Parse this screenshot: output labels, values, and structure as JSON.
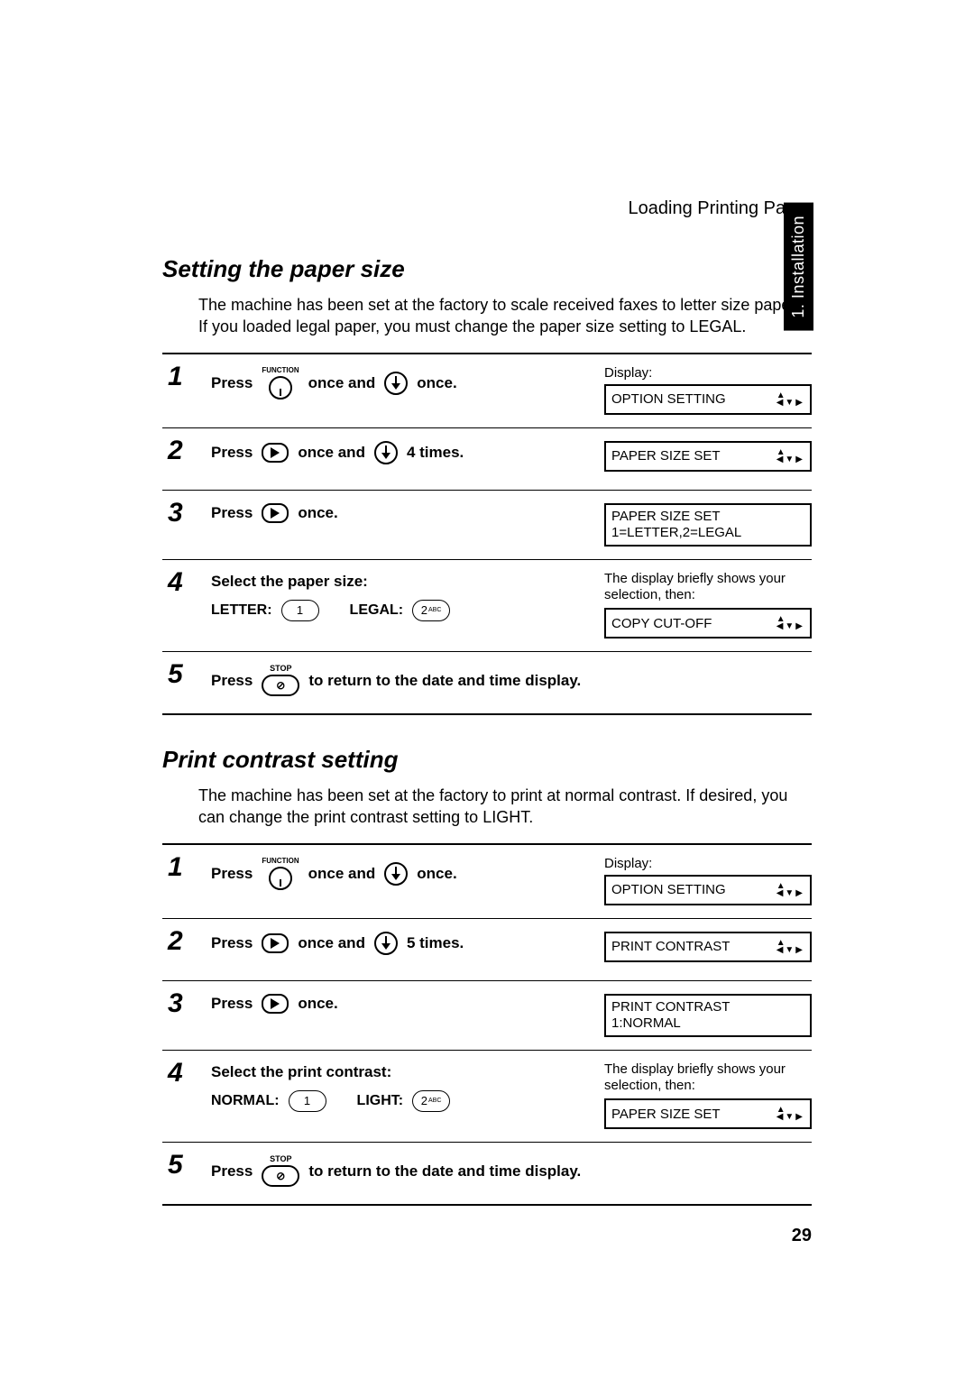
{
  "header": {
    "running_head": "Loading Printing Paper",
    "side_tab": "1. Installation"
  },
  "section1": {
    "title": "Setting the paper size",
    "intro": "The machine has been set at the factory to scale received faxes to letter size paper. If you loaded legal paper, you must change the paper size setting to LEGAL.",
    "steps": {
      "s1": {
        "num": "1",
        "press": "Press",
        "once_and": "once and",
        "once": "once.",
        "display_label": "Display:",
        "lcd": "OPTION SETTING"
      },
      "s2": {
        "num": "2",
        "press": "Press",
        "once_and": "once and",
        "times": "4 times.",
        "lcd": "PAPER SIZE SET"
      },
      "s3": {
        "num": "3",
        "press": "Press",
        "once": "once.",
        "lcd_l1": "PAPER SIZE SET",
        "lcd_l2": "1=LETTER,2=LEGAL"
      },
      "s4": {
        "num": "4",
        "select": "Select the paper size:",
        "opt1_label": "LETTER:",
        "opt1_key": "1",
        "opt2_label": "LEGAL:",
        "opt2_key": "2",
        "opt2_sub": "ABC",
        "note": "The display briefly shows your selection, then:",
        "lcd": "COPY CUT-OFF"
      },
      "s5": {
        "num": "5",
        "press": "Press",
        "tail": "to return to the date and time display."
      }
    }
  },
  "section2": {
    "title": "Print contrast setting",
    "intro": "The machine has been set at the factory to print at normal contrast. If desired, you can change the print contrast setting to LIGHT.",
    "steps": {
      "s1": {
        "num": "1",
        "press": "Press",
        "once_and": "once and",
        "once": "once.",
        "display_label": "Display:",
        "lcd": "OPTION SETTING"
      },
      "s2": {
        "num": "2",
        "press": "Press",
        "once_and": "once and",
        "times": "5 times.",
        "lcd": "PRINT CONTRAST"
      },
      "s3": {
        "num": "3",
        "press": "Press",
        "once": "once.",
        "lcd_l1": "PRINT CONTRAST",
        "lcd_l2": "1:NORMAL"
      },
      "s4": {
        "num": "4",
        "select": "Select the print contrast:",
        "opt1_label": "NORMAL:",
        "opt1_key": "1",
        "opt2_label": "LIGHT:",
        "opt2_key": "2",
        "opt2_sub": "ABC",
        "note": "The display briefly shows your selection, then:",
        "lcd": "PAPER SIZE SET"
      },
      "s5": {
        "num": "5",
        "press": "Press",
        "tail": "to return to the date and time display."
      }
    }
  },
  "key_labels": {
    "function": "FUNCTION",
    "stop": "STOP"
  },
  "page_number": "29"
}
